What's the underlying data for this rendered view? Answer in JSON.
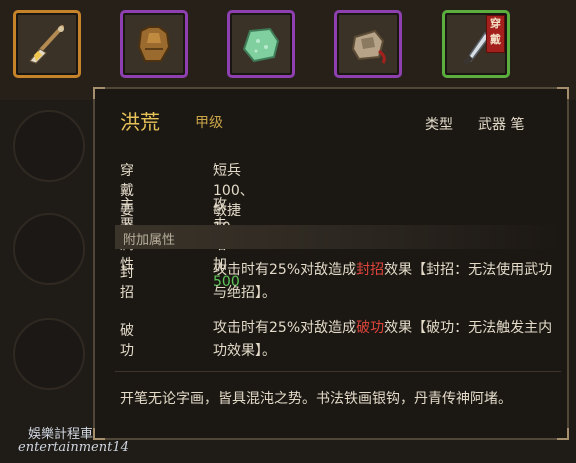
{
  "equipment_slots": [
    {
      "icon": "brush-weapon-icon",
      "frame": "orange"
    },
    {
      "icon": "armor-robe-icon",
      "frame": "purple"
    },
    {
      "icon": "jade-stone-icon",
      "frame": "purple"
    },
    {
      "icon": "pouch-icon",
      "frame": "purple"
    },
    {
      "icon": "dagger-icon",
      "frame": "green",
      "badge": "穿戴"
    }
  ],
  "item": {
    "name": "洪荒",
    "grade": "甲级",
    "type_label": "类型",
    "type_value": "武器 笔"
  },
  "requirements": {
    "label": "穿戴要求",
    "value": "短兵100、敏捷10"
  },
  "main_attr": {
    "label": "主要属性",
    "prefix": "攻击增加",
    "amount": "500"
  },
  "extra_attr_header": "附加属性",
  "effects": [
    {
      "name": "封招",
      "pre": "攻击时有25%对敌造成",
      "highlight": "封招",
      "post": "效果【封招：无法使用武功与绝招】。"
    },
    {
      "name": "破功",
      "pre": "攻击时有25%对敌造成",
      "highlight": "破功",
      "post": "效果【破功：无法触发主内功效果】。"
    }
  ],
  "description": "开笔无论字画，皆具混沌之势。书法铁画银钩，丹青传神阿堵。",
  "watermark": {
    "line1": "娛樂計程車",
    "line2": "entertainment14"
  },
  "colors": {
    "name": "#e8c35a",
    "green_value": "#5dc55a",
    "red_keyword": "#e0453c",
    "frame_orange": "#c7832a",
    "frame_purple": "#8e3fb0",
    "frame_green": "#5cae3f"
  }
}
